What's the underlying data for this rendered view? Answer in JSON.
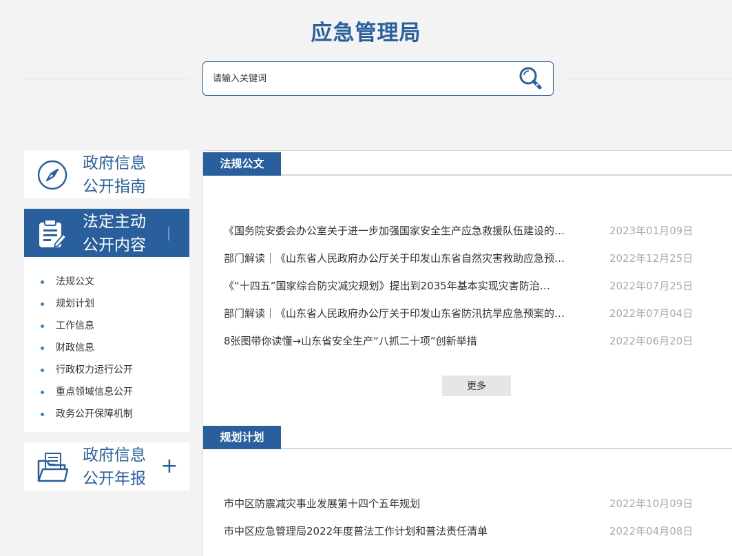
{
  "header": {
    "title": "应急管理局",
    "search_placeholder": "请输入关键词"
  },
  "sidebar": {
    "cards": [
      {
        "label_line1": "政府信息",
        "label_line2": "公开指南",
        "icon": "compass-icon"
      },
      {
        "label_line1": "法定主动",
        "label_line2": "公开内容",
        "icon": "clipboard-edit-icon",
        "items": [
          "法规公文",
          "规划计划",
          "工作信息",
          "财政信息",
          "行政权力运行公开",
          "重点领域信息公开",
          "政务公开保障机制"
        ]
      },
      {
        "label_line1": "政府信息",
        "label_line2": "公开年报",
        "icon": "folder-documents-icon",
        "expand": "+"
      }
    ]
  },
  "main": {
    "sections": [
      {
        "tab": "法规公文",
        "items": [
          {
            "title": "《国务院安委会办公室关于进一步加强国家安全生产应急救援队伍建设的…",
            "date": "2023年01月09日"
          },
          {
            "title": "部门解读｜《山东省人民政府办公厅关于印发山东省自然灾害救助应急预…",
            "date": "2022年12月25日"
          },
          {
            "title": "《“十四五”国家综合防灾减灾规划》提出到2035年基本实现灾害防治…",
            "date": "2022年07月25日"
          },
          {
            "title": "部门解读｜《山东省人民政府办公厅关于印发山东省防汛抗旱应急预案的…",
            "date": "2022年07月04日"
          },
          {
            "title": "8张图带你读懂→山东省安全生产“八抓二十项”创新举措",
            "date": "2022年06月20日"
          }
        ],
        "more": "更多"
      },
      {
        "tab": "规划计划",
        "items": [
          {
            "title": "市中区防震减灾事业发展第十四个五年规划",
            "date": "2022年10月09日"
          },
          {
            "title": "市中区应急管理局2022年度普法工作计划和普法责任清单",
            "date": "2022年04月08日"
          }
        ]
      }
    ]
  },
  "colors": {
    "brand": "#2a5f9e",
    "bullet": "#2a86d8",
    "date": "#aaaaaa",
    "background": "#f3f3f3"
  }
}
